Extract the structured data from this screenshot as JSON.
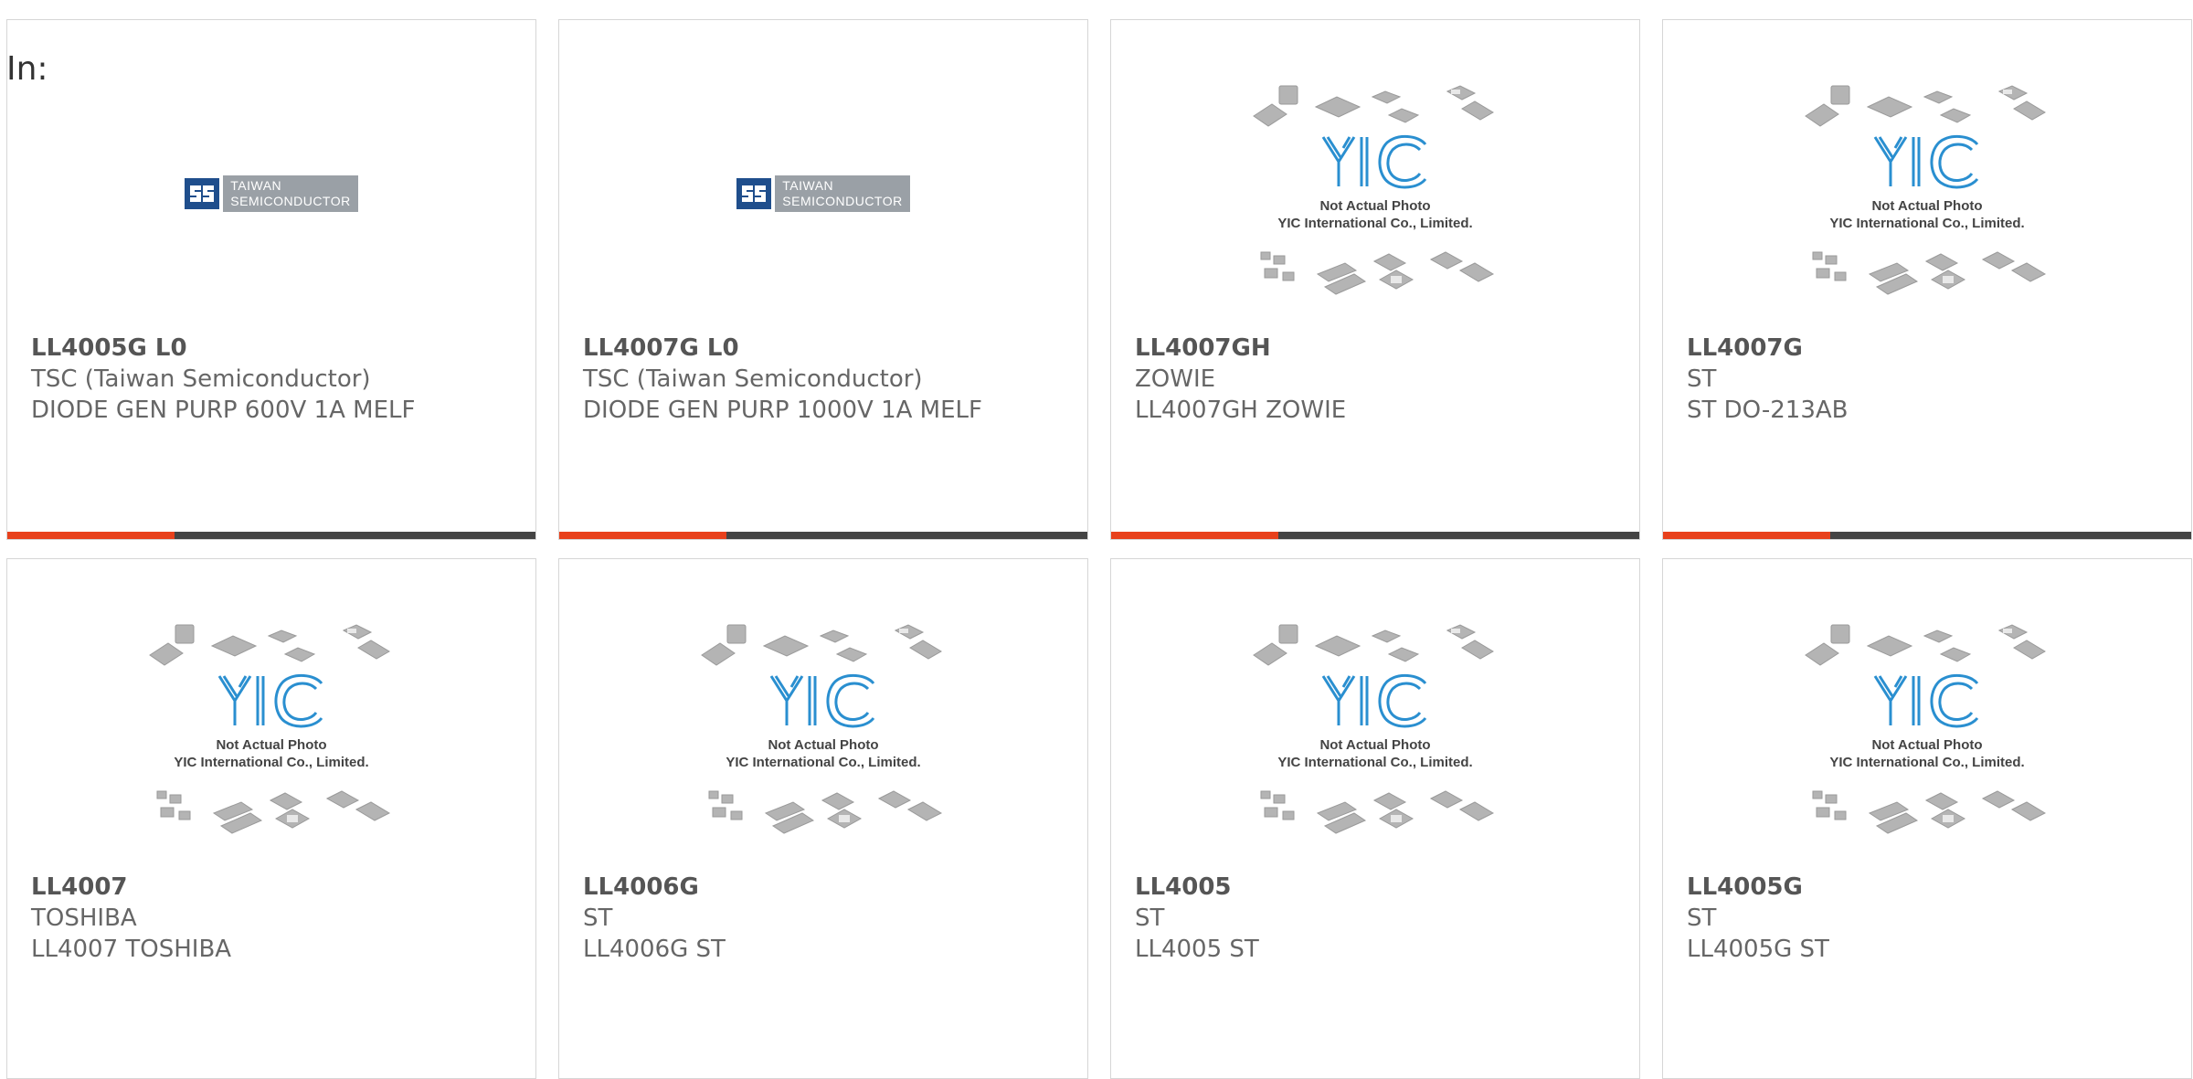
{
  "filter": {
    "label": "In:"
  },
  "brand_colors": {
    "accent": "#e8411c",
    "bar": "#444444",
    "yic_blue": "#2a8fd0"
  },
  "placeholder": {
    "line1": "Not Actual Photo",
    "line2": "YIC International Co., Limited.",
    "logo_text": "YIC"
  },
  "tsc_logo": {
    "line1": "TAIWAN",
    "line2": "SEMICONDUCTOR"
  },
  "products": [
    {
      "part": "LL4005G L0",
      "manufacturer": "TSC (Taiwan Semiconductor)",
      "description": "DIODE GEN PURP 600V 1A MELF",
      "image": "tsc-logo"
    },
    {
      "part": "LL4007G L0",
      "manufacturer": "TSC (Taiwan Semiconductor)",
      "description": "DIODE GEN PURP 1000V 1A MELF",
      "image": "tsc-logo"
    },
    {
      "part": "LL4007GH",
      "manufacturer": "ZOWIE",
      "description": "LL4007GH ZOWIE",
      "image": "yic-placeholder"
    },
    {
      "part": "LL4007G",
      "manufacturer": "ST",
      "description": "ST DO-213AB",
      "image": "yic-placeholder"
    },
    {
      "part": "LL4007",
      "manufacturer": "TOSHIBA",
      "description": "LL4007 TOSHIBA",
      "image": "yic-placeholder"
    },
    {
      "part": "LL4006G",
      "manufacturer": "ST",
      "description": "LL4006G ST",
      "image": "yic-placeholder"
    },
    {
      "part": "LL4005",
      "manufacturer": "ST",
      "description": "LL4005 ST",
      "image": "yic-placeholder"
    },
    {
      "part": "LL4005G",
      "manufacturer": "ST",
      "description": "LL4005G ST",
      "image": "yic-placeholder"
    }
  ]
}
